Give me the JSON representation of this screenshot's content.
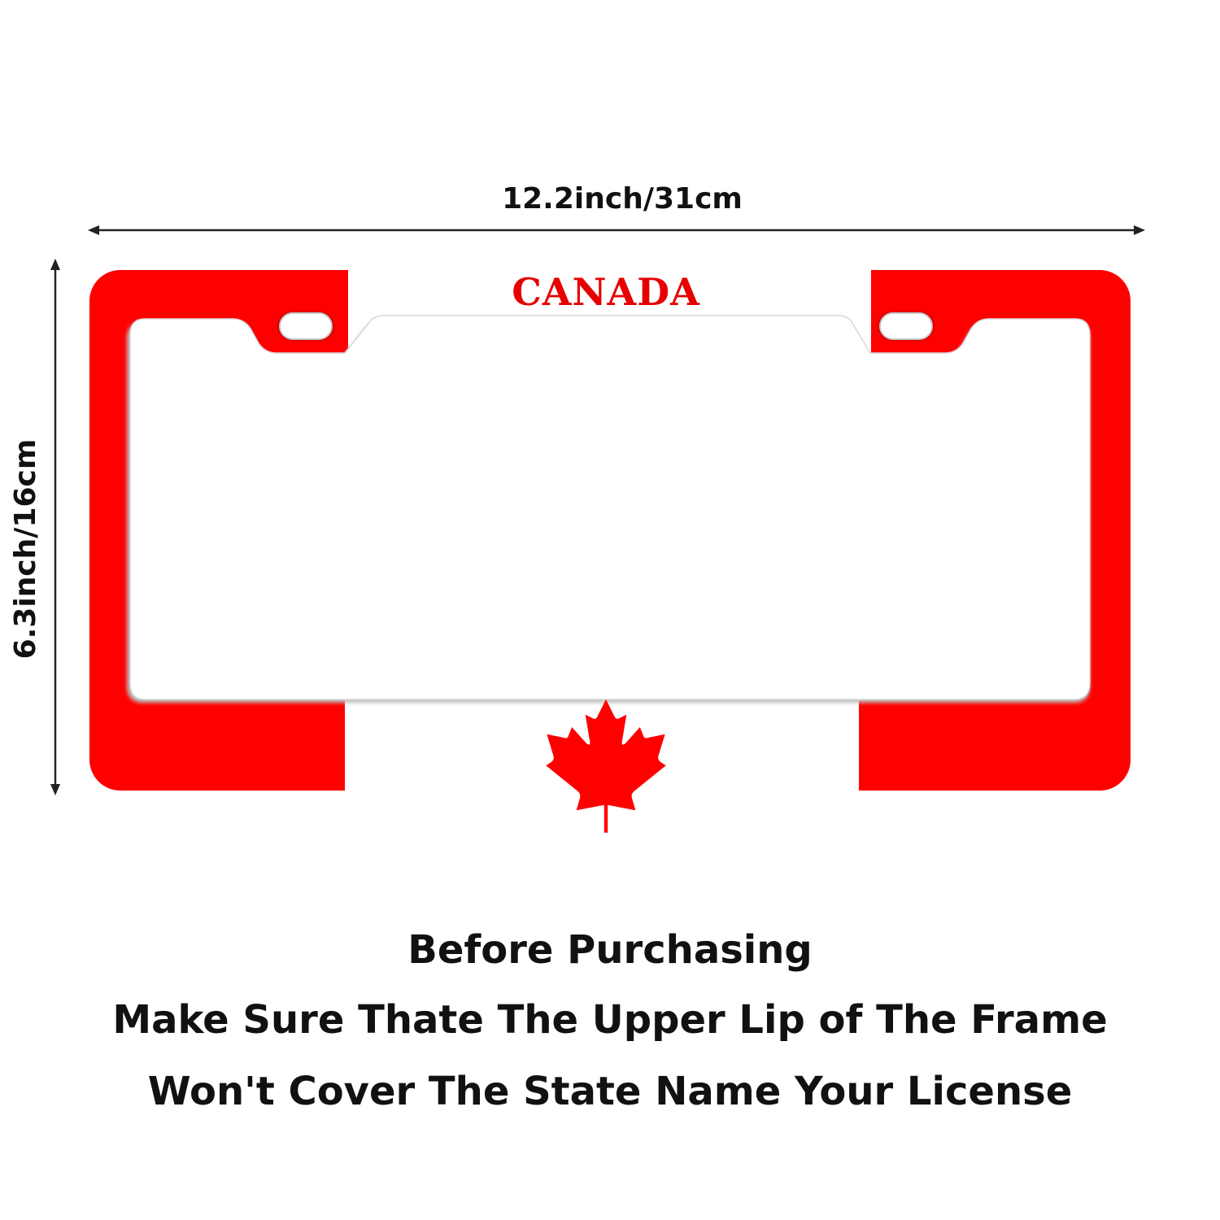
{
  "dimensions": {
    "width_label": "12.2inch/31cm",
    "height_label": "6.3inch/16cm"
  },
  "frame": {
    "text": "CANADA",
    "emblem": "maple-leaf-icon",
    "colors": {
      "red": "#ff0000",
      "white": "#ffffff"
    }
  },
  "notice": {
    "line1": "Before Purchasing",
    "line2": "Make Sure Thate The Upper Lip of The Frame",
    "line3": "Won't Cover The State Name Your License"
  }
}
